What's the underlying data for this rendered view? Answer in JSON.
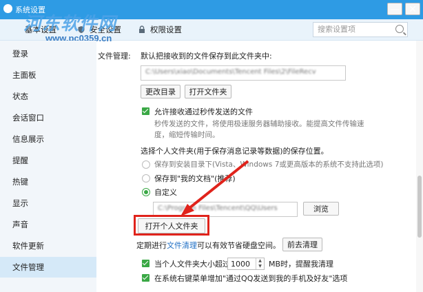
{
  "window": {
    "title": "系统设置",
    "minimize_label": "—",
    "close_label": "✕"
  },
  "tabs": [
    {
      "label": "基本设置"
    },
    {
      "label": "安全设置"
    },
    {
      "label": "权限设置"
    }
  ],
  "search": {
    "placeholder": "搜索设置项"
  },
  "watermark": {
    "text": "河东软件网",
    "url": "www.pc0359.cn"
  },
  "sidebar": {
    "items": [
      {
        "label": "登录"
      },
      {
        "label": "主面板"
      },
      {
        "label": "状态"
      },
      {
        "label": "会话窗口"
      },
      {
        "label": "信息展示"
      },
      {
        "label": "提醒"
      },
      {
        "label": "热键"
      },
      {
        "label": "显示"
      },
      {
        "label": "声音"
      },
      {
        "label": "软件更新"
      },
      {
        "label": "文件管理"
      }
    ],
    "active_index": 10
  },
  "file_management": {
    "section_label": "文件管理:",
    "default_save_text": "默认把接收到的文件保存到此文件夹中:",
    "default_path": "C:\\Users\\xiao\\Documents\\Tencent Files\\2\\FileRecv",
    "change_dir_button": "更改目录",
    "open_folder_button": "打开文件夹",
    "allow_flash_checkbox": "允许接收通过秒传发送的文件",
    "allow_flash_desc_line1": "秒传发送的文件，将使用极速服务器辅助接收。能提高文件传输速",
    "allow_flash_desc_line2": "度，缩短传输时间。",
    "personal_folder_title": "选择个人文件夹(用于保存消息记录等数据)的保存位置。",
    "option_install_dir": "保存到安装目录下(Vista、Windows 7或更高版本的系统不支持此选项)",
    "option_my_docs": "保存到\"我的文档\"(推荐)",
    "option_custom": "自定义",
    "custom_path": "C:\\Program Files\\Tencent\\QQ\\Users",
    "browse_button": "浏览",
    "open_personal_folder_button": "打开个人文件夹",
    "cleanup_prefix": "定期进行",
    "cleanup_link": "文件清理",
    "cleanup_suffix": "可以有效节省硬盘空间。",
    "cleanup_button": "前去清理",
    "size_limit_prefix": "当个人文件夹大小超过",
    "size_limit_value": "1000",
    "size_limit_suffix": "MB时，提醒我清理",
    "context_menu_checkbox": "在系统右键菜单增加\"通过QQ发送到我的手机及好友\"选项"
  },
  "colors": {
    "titlebar": "#2e9be4",
    "accent_check": "#3aa845",
    "highlight_red": "#e0231b",
    "link": "#1f6fc4"
  }
}
